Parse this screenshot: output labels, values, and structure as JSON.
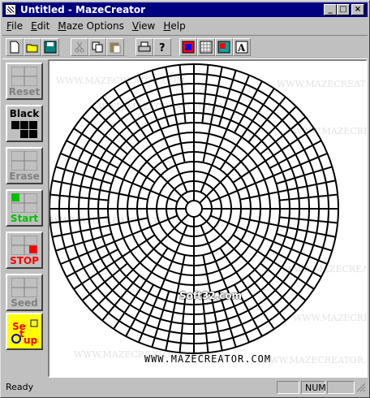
{
  "window": {
    "title": "Untitled - MazeCreator"
  },
  "menu": [
    "File",
    "Edit",
    "Maze Options",
    "View",
    "Help"
  ],
  "menu_underline": [
    "F",
    "E",
    "M",
    "V",
    "H"
  ],
  "toolbar": [
    "new",
    "open",
    "save",
    "cut",
    "copy",
    "paste",
    "print",
    "help",
    "maze-color",
    "grid",
    "color-fill",
    "text"
  ],
  "side_buttons": {
    "reset": "Reset",
    "black": "Black",
    "erase": "Erase",
    "start": "Start",
    "stop": "STOP",
    "seed": "Seed",
    "setup": "Setup"
  },
  "canvas": {
    "watermark": "WWW.MAZECREATOR.COM",
    "url": "WWW.MAZECREATOR.COM",
    "site_mark": "Soft32.com"
  },
  "status": {
    "text": "Ready",
    "num": "NUM"
  },
  "colors": {
    "title_bg": "#000080",
    "start": "#00c000",
    "stop": "#ff0000",
    "setup_bg": "#ffff00"
  }
}
